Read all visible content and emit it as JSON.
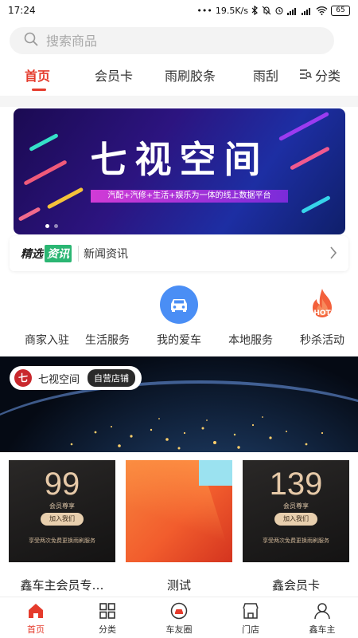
{
  "status_bar": {
    "time": "17:24",
    "network_speed": "19.5K/s",
    "battery": "65"
  },
  "search": {
    "placeholder": "搜索商品"
  },
  "tabs": [
    {
      "label": "首页",
      "active": true
    },
    {
      "label": "会员卡",
      "active": false
    },
    {
      "label": "雨刷胶条",
      "active": false
    },
    {
      "label": "雨刮",
      "active": false
    }
  ],
  "tab_category": {
    "label": "分类",
    "icon": "list-icon"
  },
  "banner": {
    "title": "七视空间",
    "subtitle": "汽配+汽修+生活+娱乐为一体的线上数据平台"
  },
  "news": {
    "logo_text_a": "精选",
    "logo_text_b": "资讯",
    "label": "新闻资讯"
  },
  "quick_menu": [
    {
      "label": "商家入驻",
      "icon": ""
    },
    {
      "label": "生活服务",
      "icon": ""
    },
    {
      "label": "我的爱车",
      "icon": "car-icon"
    },
    {
      "label": "本地服务",
      "icon": ""
    },
    {
      "label": "秒杀活动",
      "icon": "hot-flame-icon",
      "icon_text": "HOT"
    }
  ],
  "store": {
    "logo_char": "七",
    "name": "七视空间",
    "tag": "自营店铺"
  },
  "products": [
    {
      "title": "鑫车主会员专…",
      "card": {
        "price": "99",
        "line": "会员尊享",
        "button": "加入我们",
        "desc": "享受两次免费更换雨刷服务"
      }
    },
    {
      "title": "测试"
    },
    {
      "title": "鑫会员卡",
      "card": {
        "price": "139",
        "line": "会员尊享",
        "button": "加入我们",
        "desc": "享受两次免费更换雨刷服务"
      }
    }
  ],
  "bottom_nav": [
    {
      "label": "首页",
      "icon": "home-icon",
      "active": true
    },
    {
      "label": "分类",
      "icon": "grid-icon",
      "active": false
    },
    {
      "label": "车友圈",
      "icon": "car-circle-icon",
      "active": false
    },
    {
      "label": "门店",
      "icon": "store-icon",
      "active": false
    },
    {
      "label": "鑫车主",
      "icon": "user-icon",
      "active": false
    }
  ],
  "colors": {
    "accent": "#e53b2c",
    "banner_bg": "#2c1480",
    "car_icon_bg": "#4a8ef5",
    "gold_text": "#e6c9a8"
  }
}
